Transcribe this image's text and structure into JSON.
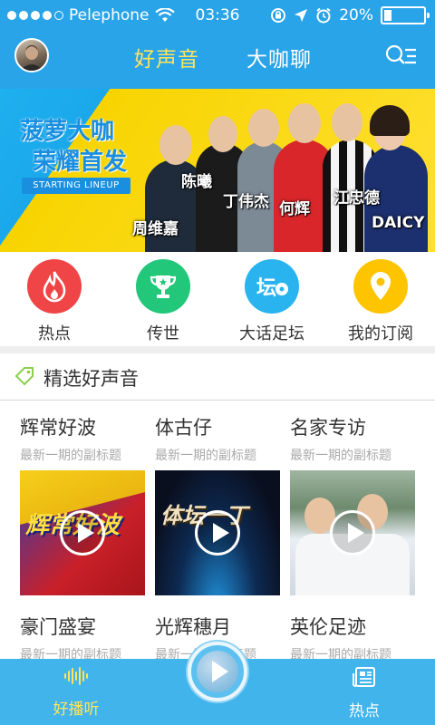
{
  "status_bar": {
    "carrier": "Pelephone",
    "time": "03:36",
    "battery_percent": "20%",
    "battery_level": 0.2,
    "signal_dots_filled": 4,
    "signal_dots_total": 5
  },
  "nav": {
    "tabs": [
      {
        "label": "好声音",
        "active": true
      },
      {
        "label": "大咖聊",
        "active": false
      }
    ],
    "avatar_icon": "user-avatar",
    "search_menu_icon": "search-menu-icon",
    "active_color": "#ffe55a"
  },
  "banner": {
    "title_line1": "菠萝大咖",
    "title_line2": "荣耀首发",
    "tagline": "STARTING LINEUP",
    "names": [
      "陈曦",
      "丁伟杰",
      "何辉",
      "江忠德",
      "周维嘉",
      "DAICY"
    ]
  },
  "categories": [
    {
      "label": "热点",
      "icon": "flame-icon",
      "color": "#f04546"
    },
    {
      "label": "传世",
      "icon": "trophy-icon",
      "color": "#22c77a"
    },
    {
      "label": "大话足坛",
      "icon": "soccer-forum-icon",
      "color": "#2ab4ef"
    },
    {
      "label": "我的订阅",
      "icon": "location-pin-icon",
      "color": "#ffc400"
    }
  ],
  "section": {
    "title": "精选好声音",
    "icon": "tag-icon"
  },
  "cards": [
    {
      "title": "辉常好波",
      "subtitle": "最新一期的副标题",
      "thumb_text": "辉常好波"
    },
    {
      "title": "体古仔",
      "subtitle": "最新一期的副标题",
      "thumb_text": "体坛一丁"
    },
    {
      "title": "名家专访",
      "subtitle": "最新一期的副标题",
      "thumb_text": ""
    },
    {
      "title": "豪门盛宴",
      "subtitle": "最新一期的副标题"
    },
    {
      "title": "光辉穗月",
      "subtitle": "最新一期的副标题"
    },
    {
      "title": "英伦足迹",
      "subtitle": "最新一期的副标题"
    }
  ],
  "bottom_bar": {
    "left_label": "好播听",
    "left_icon": "sound-wave-icon",
    "center_icon": "play-icon",
    "right_label": "热点",
    "right_icon": "news-icon",
    "left_color": "#ffe55a"
  }
}
